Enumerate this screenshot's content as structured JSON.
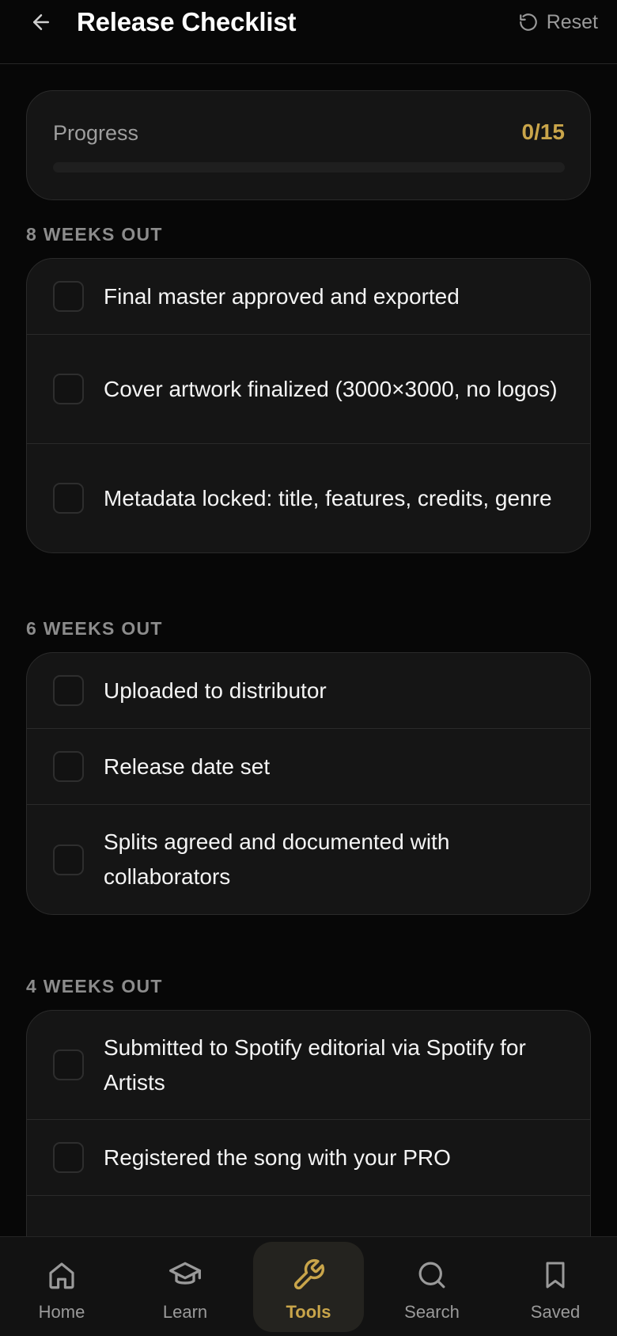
{
  "header": {
    "title": "Release Checklist",
    "reset_label": "Reset",
    "back_icon": "arrow-left-icon",
    "reset_icon": "rotate-ccw-icon"
  },
  "progress": {
    "label": "Progress",
    "count": "0/15",
    "completed": 0,
    "total": 15,
    "fraction": 0,
    "accent_color": "#c9a54a"
  },
  "sections": [
    {
      "heading": "8 WEEKS OUT",
      "items": [
        {
          "text": "Final master approved and exported",
          "checked": false
        },
        {
          "text": "Cover artwork finalized (3000×3000, no logos)",
          "checked": false
        },
        {
          "text": "Metadata locked: title, features, credits, genre",
          "checked": false
        }
      ]
    },
    {
      "heading": "6 WEEKS OUT",
      "items": [
        {
          "text": "Uploaded to distributor",
          "checked": false
        },
        {
          "text": "Release date set",
          "checked": false
        },
        {
          "text": "Splits agreed and documented with collaborators",
          "checked": false
        }
      ]
    },
    {
      "heading": "4 WEEKS OUT",
      "items": [
        {
          "text": "Submitted to Spotify editorial via Spotify for Artists",
          "checked": false
        },
        {
          "text": "Registered the song with your PRO",
          "checked": false
        }
      ]
    }
  ],
  "nav": {
    "items": [
      {
        "label": "Home",
        "icon": "home-icon",
        "active": false
      },
      {
        "label": "Learn",
        "icon": "graduation-cap-icon",
        "active": false
      },
      {
        "label": "Tools",
        "icon": "wrench-icon",
        "active": true
      },
      {
        "label": "Search",
        "icon": "search-icon",
        "active": false
      },
      {
        "label": "Saved",
        "icon": "bookmark-icon",
        "active": false
      }
    ]
  }
}
